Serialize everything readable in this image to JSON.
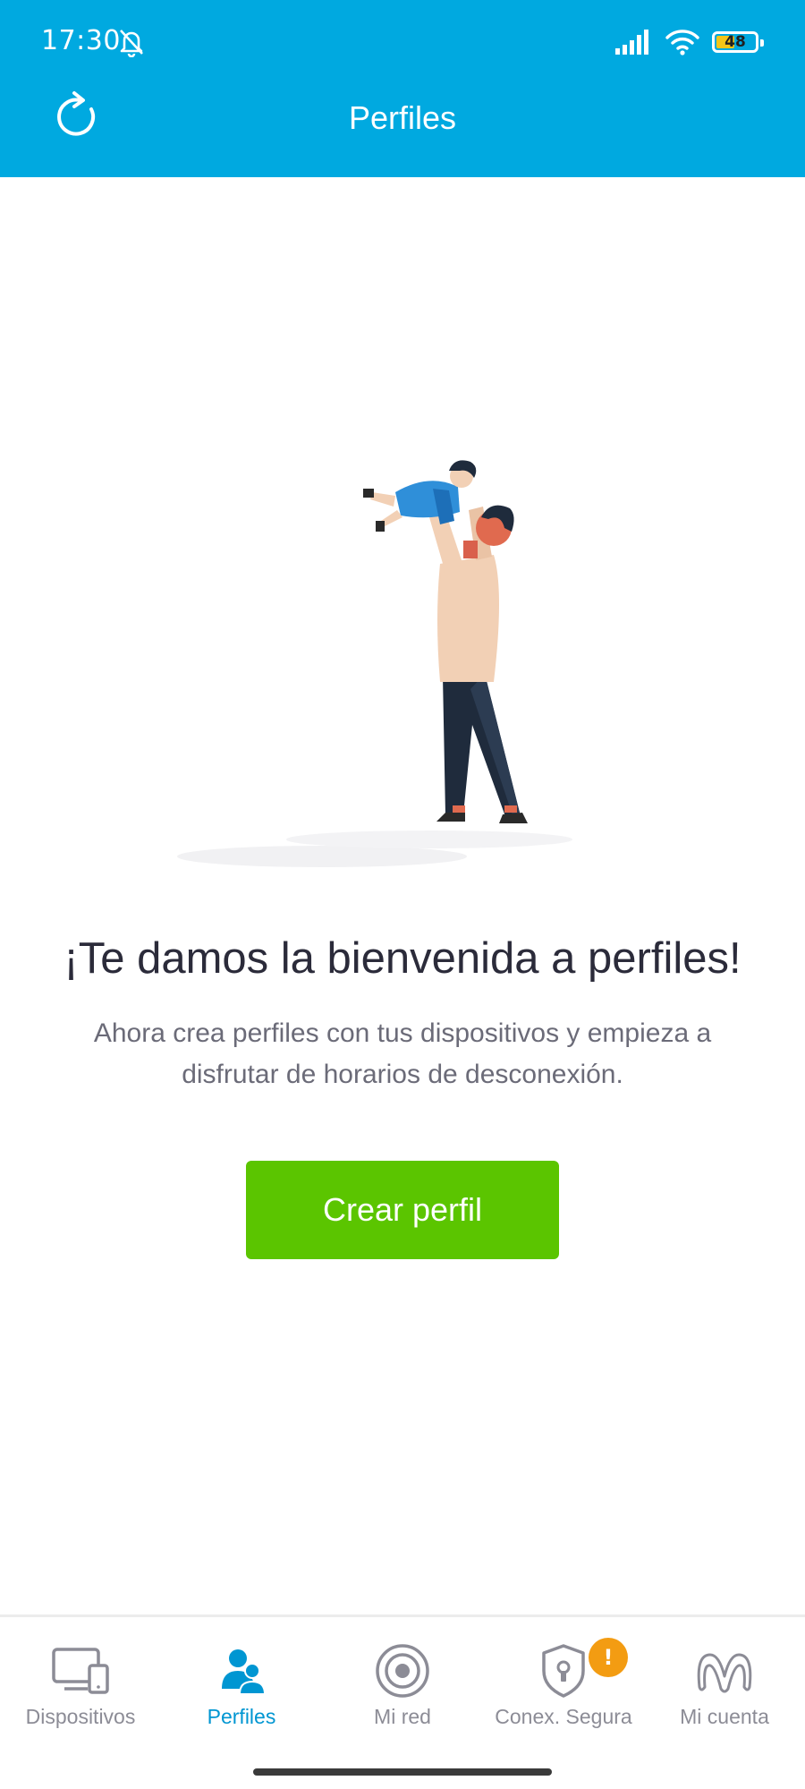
{
  "status_bar": {
    "time": "17:30",
    "battery_level": "48",
    "battery_fraction": 0.48,
    "icons": [
      "bell-off-icon",
      "signal-icon",
      "wifi-icon",
      "battery-icon"
    ]
  },
  "app_bar": {
    "title": "Perfiles",
    "refresh_icon": "refresh-icon"
  },
  "welcome": {
    "title": "¡Te damos la bienvenida a perfiles!",
    "body": "Ahora crea perfiles con tus dispositivos y empieza a disfrutar de horarios de desconexión.",
    "button_label": "Crear perfil"
  },
  "bottom_nav": {
    "items": [
      {
        "label": "Dispositivos",
        "icon": "devices-icon",
        "active": false
      },
      {
        "label": "Perfiles",
        "icon": "profiles-icon",
        "active": true
      },
      {
        "label": "Mi red",
        "icon": "network-icon",
        "active": false
      },
      {
        "label": "Conex. Segura",
        "icon": "shield-lock-icon",
        "active": false,
        "badge": "!"
      },
      {
        "label": "Mi cuenta",
        "icon": "movistar-logo-icon",
        "active": false
      }
    ]
  },
  "colors": {
    "header": "#00a9e0",
    "primary_button": "#5bc500",
    "active_nav": "#0096d2",
    "inactive_nav": "#8c8c96",
    "badge": "#f39c12"
  }
}
